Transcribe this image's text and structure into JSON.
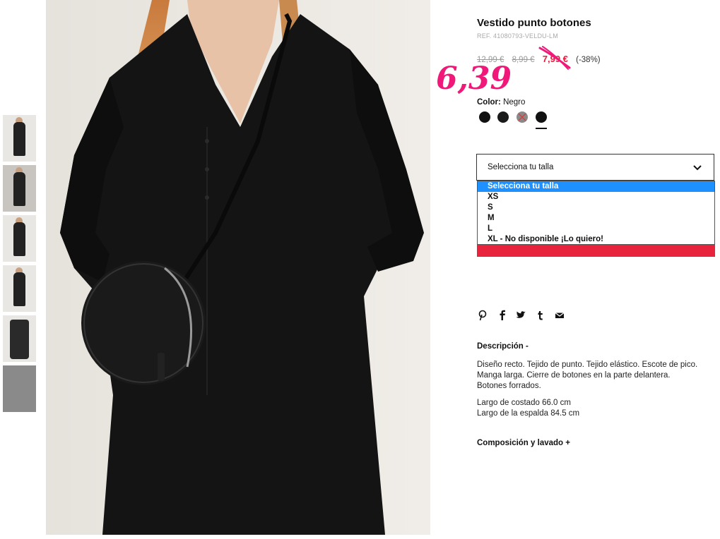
{
  "product": {
    "title": "Vestido punto botones",
    "ref": "REF. 41080793-VELDU-LM",
    "prices": {
      "original": "12,99 €",
      "previous": "8,99 €",
      "sale": "7,99 €",
      "discount": "(-38%)",
      "handwritten": "6,39"
    },
    "color": {
      "label": "Color:",
      "value": "Negro",
      "swatches": [
        "#111111",
        "#1a1a1a",
        "#8a8a8a",
        "#111111"
      ]
    }
  },
  "size_select": {
    "placeholder": "Selecciona tu talla",
    "options": [
      "Selecciona tu talla",
      "XS",
      "S",
      "M",
      "L",
      "XL - No disponible ¡Lo quiero!"
    ]
  },
  "share": {
    "icons": [
      "pinterest-icon",
      "facebook-icon",
      "twitter-icon",
      "tumblr-icon",
      "email-icon"
    ]
  },
  "description": {
    "heading": "Descripción -",
    "text_lines": [
      "Diseño recto. Tejido de punto. Tejido elástico. Escote de pico.",
      "Manga larga. Cierre de botones en la parte delantera.",
      "Botones forrados."
    ],
    "measures": [
      "Largo de costado 66.0 cm",
      "Largo de la espalda 84.5 cm"
    ]
  },
  "composition": {
    "heading": "Composición y lavado +"
  },
  "colors": {
    "sale_red": "#e8193c",
    "handwritten_pink": "#f0197a",
    "dropdown_highlight": "#1e90ff",
    "add_button_red": "#e8243c"
  }
}
